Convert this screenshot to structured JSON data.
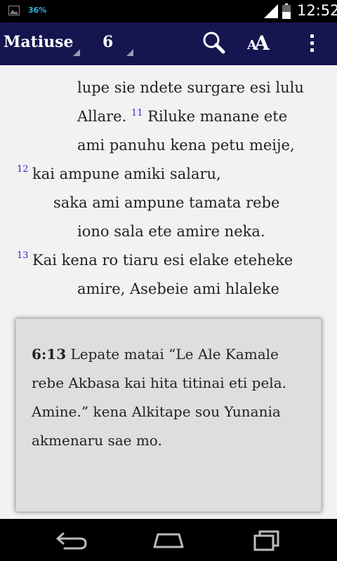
{
  "status_bar": {
    "battery_percent": "36%",
    "time": "12:52"
  },
  "action_bar": {
    "book": "Matiuse",
    "chapter": "6",
    "icons": [
      "search-icon",
      "text-size-icon",
      "overflow-menu-icon"
    ],
    "font_button_big": "A",
    "font_button_small": "A"
  },
  "reader": {
    "lines": {
      "l0": "lupe sie ndete surgare esi lulu",
      "l1a": "Allare. ",
      "l1v": "11",
      "l1b": " Riluke manane ete",
      "l2": "ami panuhu kena petu meije,",
      "l3v": "12",
      "l3": "kai ampune amiki salaru,",
      "l4": "saka ami ampune tamata rebe",
      "l5": "iono sala ete amire neka.",
      "l6v": "13",
      "l6": "Kai kena ro tiaru esi elake eteheke",
      "l7": "amire, Asebeie ami hlaleke"
    }
  },
  "footnote_popup": {
    "reference": "6:13",
    "text": " Lepate matai “Le Ale Kamale rebe Akbasa kai hita titinai eti pela. Amine.” kena Alkitape sou Yunania akmenaru sae mo."
  },
  "nav_bar": {
    "buttons": [
      "back-icon",
      "home-icon",
      "recent-apps-icon"
    ]
  },
  "colors": {
    "action_bar": "#15154f",
    "verse_number": "#2a2ad0",
    "reader_bg": "#f2f2f2",
    "popup_bg": "#dedede"
  }
}
